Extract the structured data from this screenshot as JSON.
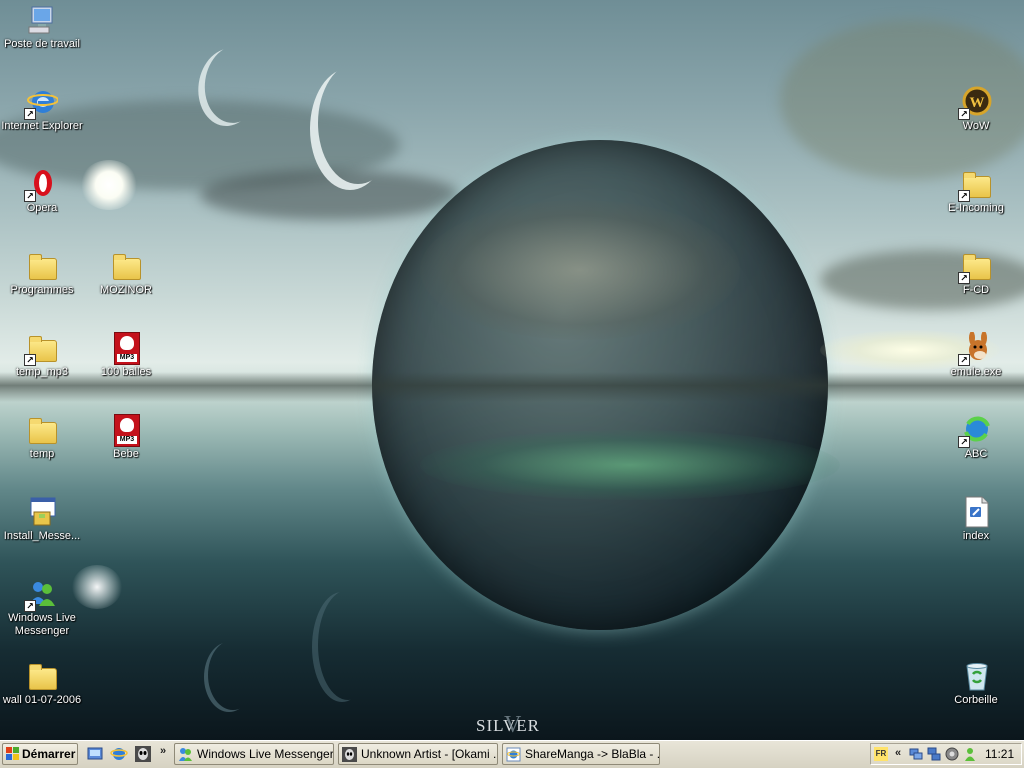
{
  "wallpaper": {
    "signature": "SILVER",
    "signature_mark": "V"
  },
  "desktop_icons_left": [
    {
      "id": "poste",
      "label": "Poste de travail",
      "icon": "my-computer-icon",
      "shortcut": false
    },
    {
      "id": "ie",
      "label": "Internet Explorer",
      "icon": "internet-explorer-icon",
      "shortcut": true
    },
    {
      "id": "opera",
      "label": "Opera",
      "icon": "opera-icon",
      "shortcut": true
    },
    {
      "id": "programmes",
      "label": "Programmes",
      "icon": "folder-icon",
      "shortcut": false
    },
    {
      "id": "mozinor",
      "label": "MOZINOR",
      "icon": "folder-icon",
      "shortcut": false
    },
    {
      "id": "temp_mp3",
      "label": "temp_mp3",
      "icon": "folder-icon",
      "shortcut": true
    },
    {
      "id": "100balles",
      "label": "100 balles",
      "icon": "mp3-file-icon",
      "shortcut": false
    },
    {
      "id": "temp",
      "label": "temp",
      "icon": "folder-icon",
      "shortcut": false
    },
    {
      "id": "bebe",
      "label": "Bebe",
      "icon": "mp3-file-icon",
      "shortcut": false
    },
    {
      "id": "install",
      "label": "Install_Messe...",
      "icon": "installer-icon",
      "shortcut": false
    },
    {
      "id": "wlm",
      "label": "Windows Live Messenger",
      "icon": "messenger-icon",
      "shortcut": true
    },
    {
      "id": "wall",
      "label": "wall 01-07-2006",
      "icon": "folder-icon",
      "shortcut": false
    }
  ],
  "desktop_icons_right": [
    {
      "id": "wow",
      "label": "WoW",
      "icon": "wow-icon",
      "shortcut": true
    },
    {
      "id": "eincoming",
      "label": "E-Incoming",
      "icon": "folder-icon",
      "shortcut": true
    },
    {
      "id": "fcd",
      "label": "F-CD",
      "icon": "folder-icon",
      "shortcut": true
    },
    {
      "id": "emule",
      "label": "emule.exe",
      "icon": "emule-icon",
      "shortcut": true
    },
    {
      "id": "abc",
      "label": "ABC",
      "icon": "abc-icon",
      "shortcut": true
    },
    {
      "id": "index",
      "label": "index",
      "icon": "text-file-icon",
      "shortcut": false
    },
    {
      "id": "corbeille",
      "label": "Corbeille",
      "icon": "recycle-bin-icon",
      "shortcut": false
    }
  ],
  "taskbar": {
    "start_label": "Démarrer",
    "quick_launch": [
      {
        "icon": "show-desktop-icon"
      },
      {
        "icon": "internet-explorer-icon"
      },
      {
        "icon": "alien-icon"
      }
    ],
    "overflow_chevron": "»",
    "tasks": [
      {
        "label": "Windows Live Messenger",
        "icon": "messenger-icon"
      },
      {
        "label": "Unknown Artist - [Okami ...",
        "icon": "alien-icon"
      },
      {
        "label": "ShareManga -> BlaBla - ...",
        "icon": "ie-page-icon"
      }
    ],
    "tray": {
      "language": "FR",
      "chevron": "«",
      "icons": [
        "network-icon",
        "network-2-icon",
        "volume-icon",
        "messenger-status-icon"
      ],
      "clock": "11:21"
    }
  }
}
